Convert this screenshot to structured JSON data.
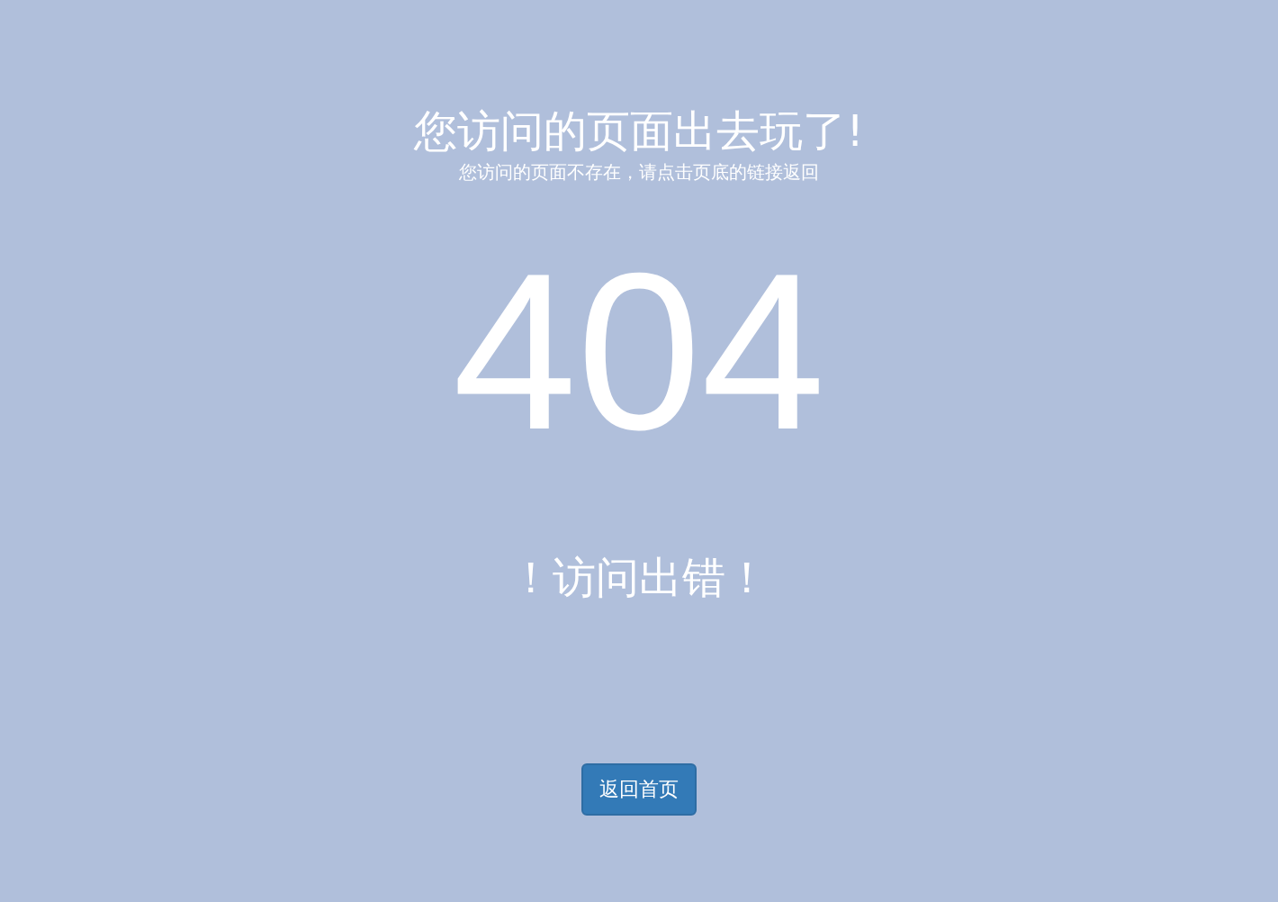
{
  "title": "您访问的页面出去玩了!",
  "subtitle": "您访问的页面不存在，请点击页底的链接返回",
  "code": "404",
  "message": "！访问出错！",
  "button": "返回首页"
}
